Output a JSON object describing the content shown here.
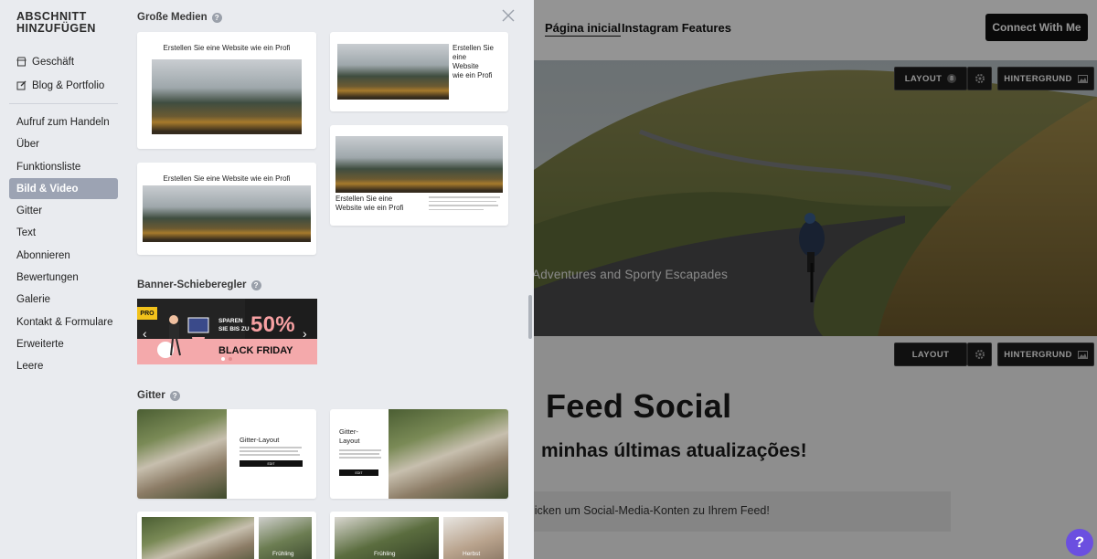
{
  "sidebar": {
    "title": "ABSCHNITT HINZUFÜGEN",
    "top_items": [
      {
        "label": "Geschäft",
        "icon": "store-icon"
      },
      {
        "label": "Blog & Portfolio",
        "icon": "edit-icon"
      }
    ],
    "items": [
      {
        "label": "Aufruf zum Handeln",
        "active": false
      },
      {
        "label": "Über",
        "active": false
      },
      {
        "label": "Funktionsliste",
        "active": false
      },
      {
        "label": "Bild & Video",
        "active": true
      },
      {
        "label": "Gitter",
        "active": false
      },
      {
        "label": "Text",
        "active": false
      },
      {
        "label": "Abonnieren",
        "active": false
      },
      {
        "label": "Bewertungen",
        "active": false
      },
      {
        "label": "Galerie",
        "active": false
      },
      {
        "label": "Kontakt & Formulare",
        "active": false
      },
      {
        "label": "Erweiterte",
        "active": false
      },
      {
        "label": "Leere",
        "active": false
      }
    ],
    "active_color": "#9ca3b3"
  },
  "panel": {
    "sections": {
      "large_media": "Große Medien",
      "banner_slider": "Banner-Schieberegler",
      "grid": "Gitter"
    },
    "cards": {
      "heading": "Erstellen Sie eine Website wie ein Profi",
      "heading_lines": [
        "Erstellen Sie eine",
        "Website",
        "wie ein Profi"
      ],
      "heading_two_lines": [
        "Erstellen Sie eine",
        "Website wie ein Profi"
      ]
    },
    "banner": {
      "pro_badge": "PRO",
      "sparen_line1": "SPAREN",
      "sparen_line2": "SIE BIS ZU",
      "percent": "50%",
      "black_friday": "BLACK FRIDAY"
    },
    "grid_cards": {
      "layout_title": "Gitter-Layout",
      "layout_title_line1": "Gitter-",
      "layout_title_line2": "Layout",
      "labels": [
        "Frühling",
        "Frühling",
        "Herbst"
      ]
    }
  },
  "site": {
    "nav": [
      "Página inicial",
      "Instagram Features"
    ],
    "connect_button": "Connect With Me",
    "hero_tagline": "Adventures and Sporty Escapades",
    "toolbar": {
      "layout": "LAYOUT",
      "layout_badge": "8",
      "background": "HINTERGRUND"
    },
    "feed_title": "Feed Social",
    "feed_subtitle": "minhas últimas atualizações!",
    "feed_placeholder": "licken um Social-Media-Konten zu Ihrem Feed!",
    "help": "?"
  }
}
